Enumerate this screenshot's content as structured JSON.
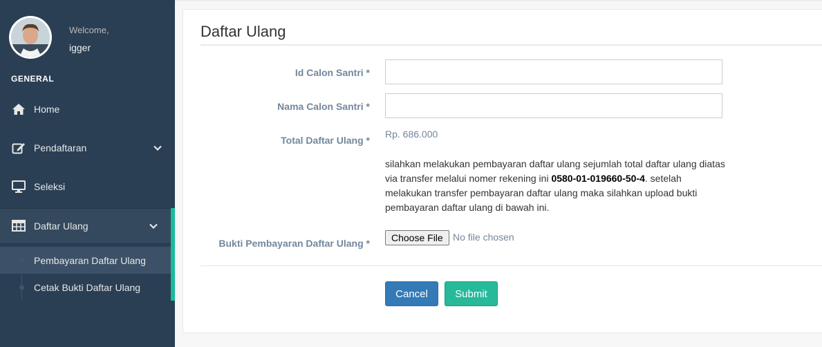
{
  "profile": {
    "welcome": "Welcome,",
    "username": "igger"
  },
  "sidebar": {
    "section_title": "GENERAL",
    "items": [
      {
        "label": "Home",
        "icon": "home-icon"
      },
      {
        "label": "Pendaftaran",
        "icon": "edit-icon",
        "has_submenu": true
      },
      {
        "label": "Seleksi",
        "icon": "desktop-icon"
      },
      {
        "label": "Daftar Ulang",
        "icon": "table-icon",
        "has_submenu": true,
        "active": true
      }
    ],
    "submenu": [
      {
        "label": "Pembayaran Daftar Ulang",
        "current": true
      },
      {
        "label": "Cetak Bukti Daftar Ulang"
      }
    ]
  },
  "main": {
    "title": "Daftar Ulang",
    "form": {
      "id_label": "Id Calon Santri *",
      "id_value": "",
      "nama_label": "Nama Calon Santri *",
      "nama_value": "",
      "total_label": "Total Daftar Ulang *",
      "total_value": "Rp. 686.000",
      "instruction_part1": "silahkan melakukan pembayaran daftar ulang sejumlah total daftar ulang diatas via transfer melalui nomer rekening ini ",
      "account_number": "0580-01-019660-50-4",
      "instruction_part2": ". setelah melakukan transfer pembayaran daftar ulang maka silahkan upload bukti pembayaran daftar ulang di bawah ini.",
      "bukti_label": "Bukti Pembayaran Daftar Ulang *",
      "file_button": "Choose File",
      "file_status": "No file chosen"
    },
    "buttons": {
      "cancel": "Cancel",
      "submit": "Submit"
    }
  },
  "colors": {
    "sidebar_bg": "#2a3f54",
    "accent": "#1abb9c",
    "cancel": "#337ab7",
    "submit": "#26b99a"
  }
}
